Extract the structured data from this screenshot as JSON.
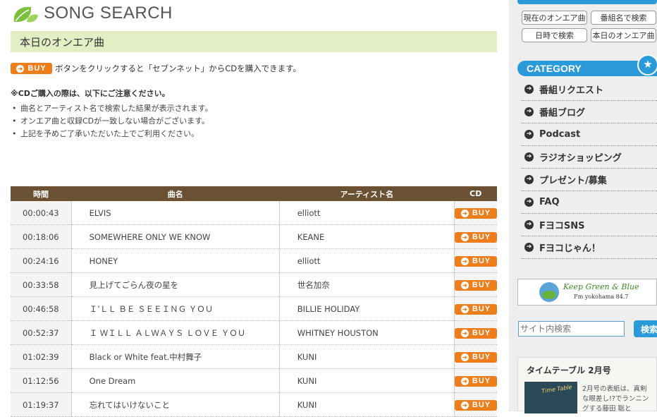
{
  "header": {
    "title": "SONG SEARCH"
  },
  "section": {
    "title": "本日のオンエア曲"
  },
  "buy_label": "BUY",
  "buy_note": "ボタンをクリックすると「セブンネット」からCDを購入できます。",
  "notice": "※CDご購入の際は、以下にご注意ください。",
  "bullets": [
    "曲名とアーティスト名で検索した結果が表示されます。",
    "オンエア曲と収録CDが一致しない場合がございます。",
    "上記を予めご了承いただいた上でご利用ください。"
  ],
  "table": {
    "headers": [
      "時間",
      "曲名",
      "アーティスト名",
      "CD"
    ],
    "rows": [
      {
        "time": "00:00:43",
        "title": "ELVIS",
        "artist": "elliott"
      },
      {
        "time": "00:18:06",
        "title": "SOMEWHERE ONLY WE KNOW",
        "artist": "KEANE"
      },
      {
        "time": "00:24:16",
        "title": "HONEY",
        "artist": "elliott"
      },
      {
        "time": "00:33:58",
        "title": "見上げてごらん夜の星を",
        "artist": "世名加奈"
      },
      {
        "time": "00:46:58",
        "title": "Ｉ’ＬＬ ＢＥ ＳＥＥＩＮＧ ＹＯＵ",
        "artist": "BILLIE HOLIDAY"
      },
      {
        "time": "00:52:37",
        "title": "Ｉ ＷＩＬＬ ＡＬＷＡＹＳ ＬＯＶＥ ＹＯＵ",
        "artist": "WHITNEY HOUSTON"
      },
      {
        "time": "01:02:39",
        "title": "Black or White feat.中村舞子",
        "artist": "KUNI"
      },
      {
        "time": "01:12:56",
        "title": "One Dream",
        "artist": "KUNI"
      },
      {
        "time": "01:19:37",
        "title": "忘れてはいけないこと",
        "artist": "KUNI"
      }
    ]
  },
  "sidebar": {
    "search_buttons": [
      "現在のオンエア曲",
      "番組名で検索",
      "日時で検索",
      "本日のオンエア曲"
    ],
    "category_title": "CATEGORY",
    "categories": [
      "番組リクエスト",
      "番組ブログ",
      "Podcast",
      "ラジオショッピング",
      "プレゼント/募集",
      "FAQ",
      "FヨコSNS",
      "Fヨコじゃん！"
    ],
    "banner": {
      "line1": "Keep Green & Blue",
      "line2": "Fm yokohama 84.7"
    },
    "site_search": {
      "placeholder": "サイト内検索",
      "button": "検索"
    },
    "timetable": {
      "title": "タイムテーブル 2月号",
      "cover_text": "Time Table",
      "text": "2月号の表紙は、真剣な眼差し!?でランニングする藤田 聡と"
    }
  },
  "colors": {
    "accent": "#2a9ad8",
    "buy": "#ee7d1c",
    "table_head": "#6b5133",
    "section_bg": "#e3eec5"
  }
}
